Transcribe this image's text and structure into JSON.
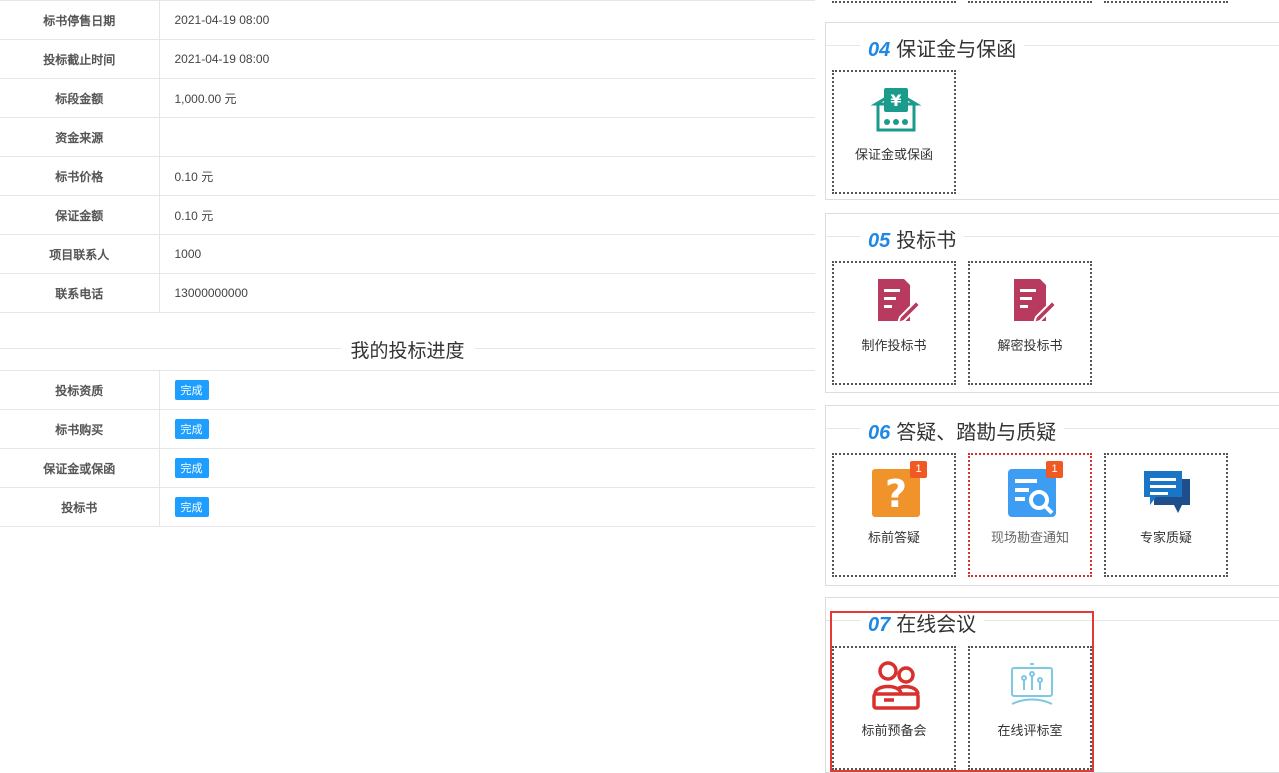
{
  "info_rows": [
    {
      "label": "标书停售日期",
      "value": "2021-04-19 08:00"
    },
    {
      "label": "投标截止时间",
      "value": "2021-04-19 08:00"
    },
    {
      "label": "标段金额",
      "value": "1,000.00 元"
    },
    {
      "label": "资金来源",
      "value": ""
    },
    {
      "label": "标书价格",
      "value": "0.10 元"
    },
    {
      "label": "保证金额",
      "value": "0.10 元"
    },
    {
      "label": "项目联系人",
      "value": "1000"
    },
    {
      "label": "联系电话",
      "value": "13000000000"
    }
  ],
  "progress": {
    "title": "我的投标进度",
    "rows": [
      {
        "label": "投标资质",
        "status": "完成"
      },
      {
        "label": "标书购买",
        "status": "完成"
      },
      {
        "label": "保证金或保函",
        "status": "完成"
      },
      {
        "label": "投标书",
        "status": "完成"
      }
    ]
  },
  "sections": [
    {
      "num": "04",
      "title": "保证金与保函",
      "tiles": [
        {
          "label": "保证金或保函",
          "icon": "bank-yuan-icon",
          "color": "#1a9b8c"
        }
      ]
    },
    {
      "num": "05",
      "title": "投标书",
      "tiles": [
        {
          "label": "制作投标书",
          "icon": "document-edit-icon",
          "color": "#b83a5e"
        },
        {
          "label": "解密投标书",
          "icon": "document-edit-icon",
          "color": "#b83a5e"
        }
      ]
    },
    {
      "num": "06",
      "title": "答疑、踏勘与质疑",
      "tiles": [
        {
          "label": "标前答疑",
          "icon": "question-icon",
          "color": "#f0932b",
          "count": "1"
        },
        {
          "label": "现场勘查通知",
          "icon": "search-document-icon",
          "color": "#3d9df3",
          "count": "1"
        },
        {
          "label": "专家质疑",
          "icon": "chat-bubble-icon",
          "color": "#1976c6"
        }
      ]
    },
    {
      "num": "07",
      "title": "在线会议",
      "tiles": [
        {
          "label": "标前预备会",
          "icon": "meeting-people-icon",
          "color": "#d9302d"
        },
        {
          "label": "在线评标室",
          "icon": "presentation-board-icon",
          "color": "#7ec8e3"
        }
      ]
    }
  ]
}
